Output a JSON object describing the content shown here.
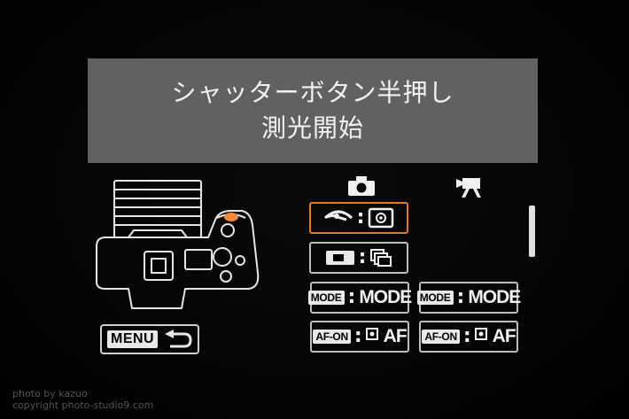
{
  "banner": {
    "line1": "シャッターボタン半押し",
    "line2": "測光開始"
  },
  "menu": {
    "label": "MENU"
  },
  "columns": {
    "photo": "camera-icon",
    "movie": "movie-camera-icon"
  },
  "rows": [
    {
      "left": {
        "tag": "",
        "value": "",
        "icon_l": "eye-icon",
        "icon_r": "metering-icon",
        "selected": true
      }
    },
    {
      "left": {
        "tag": "",
        "value": "",
        "icon_l": "viewfinder-icon",
        "icon_r": "drive-mode-icon",
        "selected": false
      }
    },
    {
      "left": {
        "tag": "MODE",
        "value": "MODE"
      },
      "right": {
        "tag": "MODE",
        "value": "MODE"
      }
    },
    {
      "left": {
        "tag": "AF-ON",
        "value": "AF"
      },
      "right": {
        "tag": "AF-ON",
        "value": "AF"
      }
    }
  ],
  "accent_color": "#e07a25",
  "watermark": {
    "line1": "photo by kazuo",
    "line2": "copyright photo-studio9.com"
  }
}
